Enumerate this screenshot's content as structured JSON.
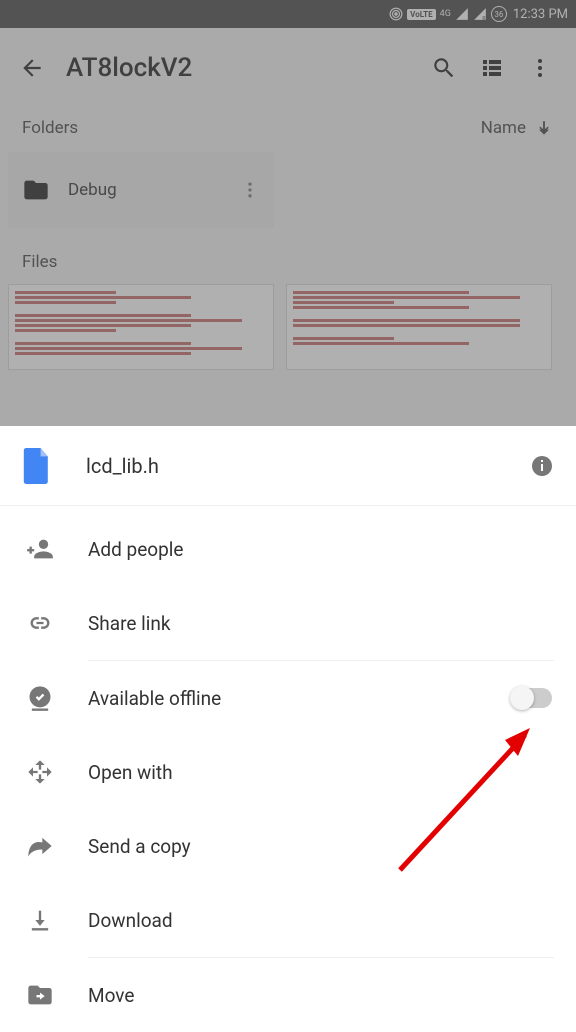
{
  "status": {
    "volte": "VoLTE",
    "network": "4G",
    "battery": "36",
    "time": "12:33 PM"
  },
  "app_bar": {
    "title": "AT8lockV2"
  },
  "sections": {
    "folders_label": "Folders",
    "sort_label": "Name",
    "files_label": "Files"
  },
  "folder": {
    "name": "Debug"
  },
  "sheet": {
    "filename": "lcd_lib.h",
    "items": {
      "add_people": "Add people",
      "share_link": "Share link",
      "available_offline": "Available offline",
      "open_with": "Open with",
      "send_copy": "Send a copy",
      "download": "Download",
      "move": "Move"
    }
  }
}
